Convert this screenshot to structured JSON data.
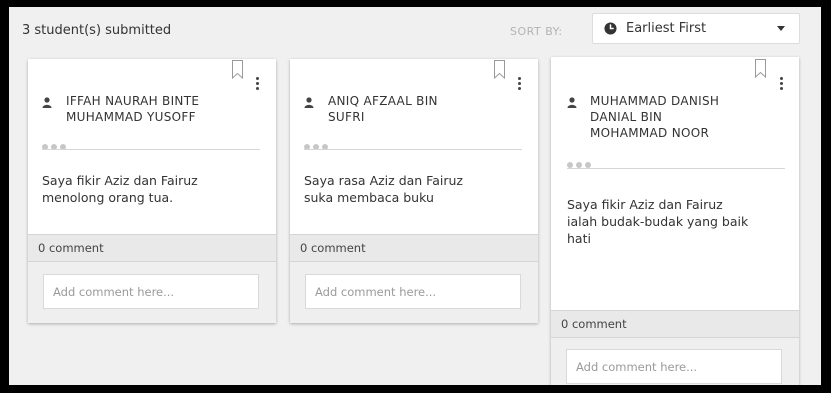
{
  "header": {
    "submitted_count": "3 student(s) submitted",
    "sort_label": "SORT BY:",
    "sort_value": "Earliest First",
    "sort_icon": "clock-icon"
  },
  "cards": [
    {
      "author_lines": [
        "IFFAH NAURAH BINTE",
        "MUHAMMAD YUSOFF"
      ],
      "body_lines": [
        "Saya fikir Aziz dan Fairuz",
        "menolong orang tua."
      ],
      "comment_count": "0 comment",
      "comment_placeholder": "Add comment here..."
    },
    {
      "author_lines": [
        "ANIQ AFZAAL BIN",
        "SUFRI"
      ],
      "body_lines": [
        "Saya rasa Aziz dan Fairuz",
        "suka membaca buku"
      ],
      "comment_count": "0 comment",
      "comment_placeholder": "Add comment here..."
    },
    {
      "author_lines": [
        "MUHAMMAD DANISH",
        "DANIAL BIN",
        "MOHAMMAD NOOR"
      ],
      "body_lines": [
        "Saya fikir Aziz dan Fairuz",
        "ialah budak-budak yang baik",
        "hati"
      ],
      "comment_count": "0 comment",
      "comment_placeholder": "Add comment here..."
    }
  ],
  "colors": {
    "background": "#f0f0f0",
    "card": "#ffffff",
    "comment_bar": "#e9e9e9",
    "muted_text": "#b3b3b3",
    "text": "#333333"
  }
}
